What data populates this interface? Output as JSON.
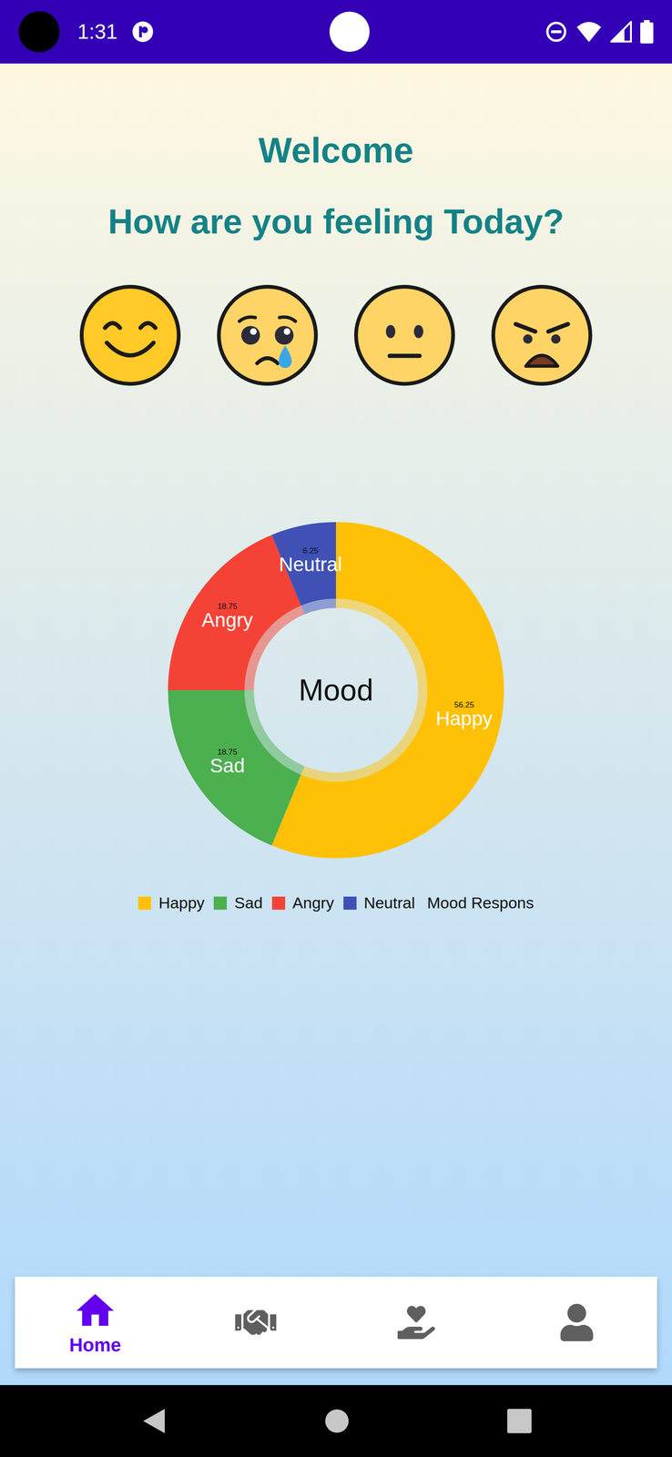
{
  "status_bar": {
    "time": "1:31"
  },
  "header": {
    "title": "Welcome",
    "subtitle": "How are you feeling Today?"
  },
  "moods": [
    {
      "kind": "happy"
    },
    {
      "kind": "sad"
    },
    {
      "kind": "neutral"
    },
    {
      "kind": "angry"
    }
  ],
  "chart": {
    "center_label": "Mood",
    "series": [
      {
        "label": "Happy",
        "value": 56.25,
        "value_text": "56.25",
        "color": "#FFC107"
      },
      {
        "label": "Sad",
        "value": 18.75,
        "value_text": "18.75",
        "color": "#4CAF50"
      },
      {
        "label": "Angry",
        "value": 18.75,
        "value_text": "18.75",
        "color": "#F44336"
      },
      {
        "label": "Neutral",
        "value": 6.25,
        "value_text": "6.25",
        "color": "#3F51B5"
      }
    ],
    "legend": {
      "items": [
        {
          "label": "Happy",
          "color": "#FFC107"
        },
        {
          "label": "Sad",
          "color": "#4CAF50"
        },
        {
          "label": "Angry",
          "color": "#F44336"
        },
        {
          "label": "Neutral",
          "color": "#3F51B5"
        }
      ],
      "series_title": "Mood Respons"
    }
  },
  "bottom_nav": {
    "items": [
      {
        "kind": "home",
        "label": "Home",
        "selected": true
      },
      {
        "kind": "community",
        "selected": false
      },
      {
        "kind": "care",
        "selected": false
      },
      {
        "kind": "profile",
        "selected": false
      }
    ]
  }
}
